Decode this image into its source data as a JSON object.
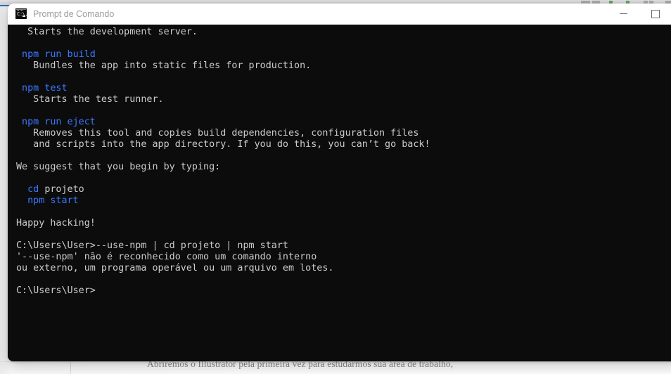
{
  "background": {
    "caption": "Abriremos o Illustrator pela primeira vez para estudarmos sua área de trabalho,",
    "accent_color": "#2b6fc2",
    "surface_color": "#ffffff"
  },
  "window": {
    "title": "Prompt de Comando",
    "icon": "console-icon",
    "icon_glyph": "C:\\.",
    "titlebar_background": "#ffffff",
    "title_color": "#9b9b9e",
    "controls": [
      {
        "name": "minimize-button",
        "label": "Minimizar",
        "glyph": "minimize-icon"
      },
      {
        "name": "maximize-button",
        "label": "Maximizar",
        "glyph": "maximize-icon"
      }
    ]
  },
  "terminal": {
    "background_color": "#0c0c0c",
    "foreground_color": "#ccccd0",
    "command_color": "#3b78ff",
    "prompt": "C:\\Users\\User>",
    "lines": [
      {
        "type": "text",
        "text": "  Starts the development server."
      },
      {
        "type": "blank",
        "text": ""
      },
      {
        "type": "command",
        "text": " npm run build"
      },
      {
        "type": "text",
        "text": "   Bundles the app into static files for production."
      },
      {
        "type": "blank",
        "text": ""
      },
      {
        "type": "command",
        "text": " npm test"
      },
      {
        "type": "text",
        "text": "   Starts the test runner."
      },
      {
        "type": "blank",
        "text": ""
      },
      {
        "type": "command",
        "text": " npm run eject"
      },
      {
        "type": "text",
        "text": "   Removes this tool and copies build dependencies, configuration files"
      },
      {
        "type": "text",
        "text": "   and scripts into the app directory. If you do this, you can’t go back!"
      },
      {
        "type": "blank",
        "text": ""
      },
      {
        "type": "text",
        "text": "We suggest that you begin by typing:"
      },
      {
        "type": "blank",
        "text": ""
      },
      {
        "type": "mixed",
        "cmd": "  cd ",
        "text": "projeto"
      },
      {
        "type": "command",
        "text": "  npm start"
      },
      {
        "type": "blank",
        "text": ""
      },
      {
        "type": "text",
        "text": "Happy hacking!"
      },
      {
        "type": "blank",
        "text": ""
      },
      {
        "type": "text",
        "text": "C:\\Users\\User>--use-npm | cd projeto | npm start"
      },
      {
        "type": "text",
        "text": "'--use-npm' não é reconhecido como um comando interno"
      },
      {
        "type": "text",
        "text": "ou externo, um programa operável ou um arquivo em lotes."
      },
      {
        "type": "blank",
        "text": ""
      },
      {
        "type": "text",
        "text": "C:\\Users\\User>"
      }
    ]
  }
}
